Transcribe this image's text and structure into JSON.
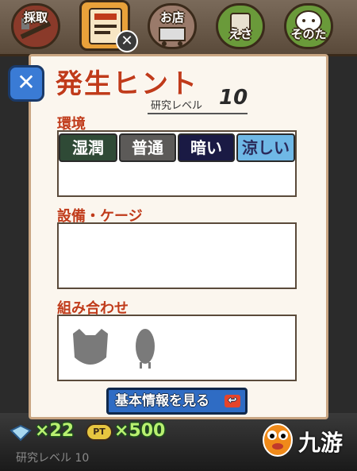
{
  "tabs": [
    {
      "label": "採取",
      "icon": "shovel-icon"
    },
    {
      "label": "研究",
      "icon": "research-book-icon"
    },
    {
      "label": "お店",
      "icon": "cart-icon"
    },
    {
      "label": "えさ",
      "icon": "food-bag-icon"
    },
    {
      "label": "そのた",
      "icon": "face-icon"
    }
  ],
  "panel": {
    "title": "発生ヒント",
    "level_label": "研究レベル",
    "level_value": "10",
    "env_label": "環境",
    "env_options": [
      "湿潤",
      "普通",
      "暗い",
      "涼しい"
    ],
    "equipment_label": "設備・ケージ",
    "combo_label": "組み合わせ",
    "info_button": "基本情報を見る"
  },
  "status": {
    "gem_count": "×22",
    "pt_badge": "PT",
    "pt_count": "×500",
    "research_level_text": "研究レベル 10"
  },
  "watermark": "九游",
  "colors": {
    "title_red": "#c03b1a",
    "panel_bg": "#fbf6ee",
    "button_blue": "#2f6cc4",
    "stat_green": "#b8f070"
  }
}
